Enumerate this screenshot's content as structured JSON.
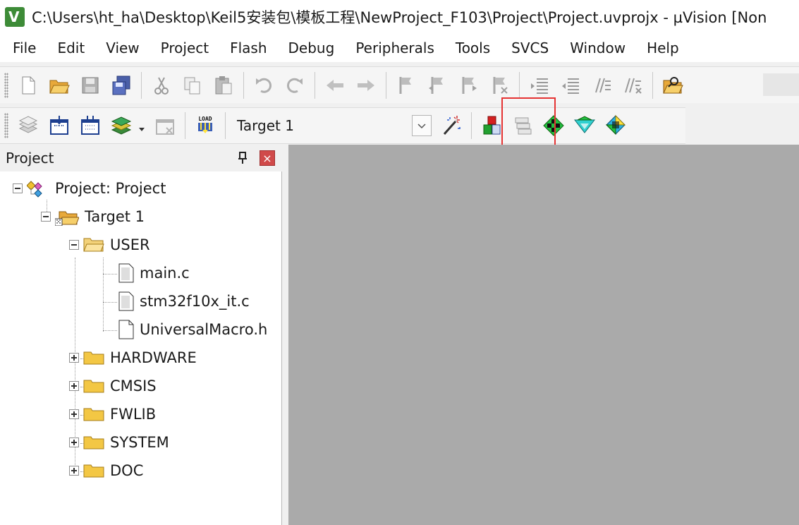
{
  "window": {
    "title": "C:\\Users\\ht_ha\\Desktop\\Keil5安装包\\模板工程\\NewProject_F103\\Project\\Project.uvprojx - µVision  [Non"
  },
  "menu": [
    "File",
    "Edit",
    "View",
    "Project",
    "Flash",
    "Debug",
    "Peripherals",
    "Tools",
    "SVCS",
    "Window",
    "Help"
  ],
  "build_toolbar": {
    "target_select": "Target 1",
    "load_label": "LOAD"
  },
  "project_panel": {
    "title": "Project",
    "close_glyph": "×",
    "tree": {
      "root": "Project: Project",
      "target": "Target 1",
      "groups": [
        {
          "name": "USER",
          "expanded": true,
          "files": [
            "main.c",
            "stm32f10x_it.c",
            "UniversalMacro.h"
          ]
        },
        {
          "name": "HARDWARE",
          "expanded": false
        },
        {
          "name": "CMSIS",
          "expanded": false
        },
        {
          "name": "FWLIB",
          "expanded": false
        },
        {
          "name": "SYSTEM",
          "expanded": false
        },
        {
          "name": "DOC",
          "expanded": false
        }
      ]
    }
  },
  "colors": {
    "highlight_box": "#e53333",
    "workspace_bg": "#aaaaaa",
    "folder_yellow": "#f3c744"
  }
}
